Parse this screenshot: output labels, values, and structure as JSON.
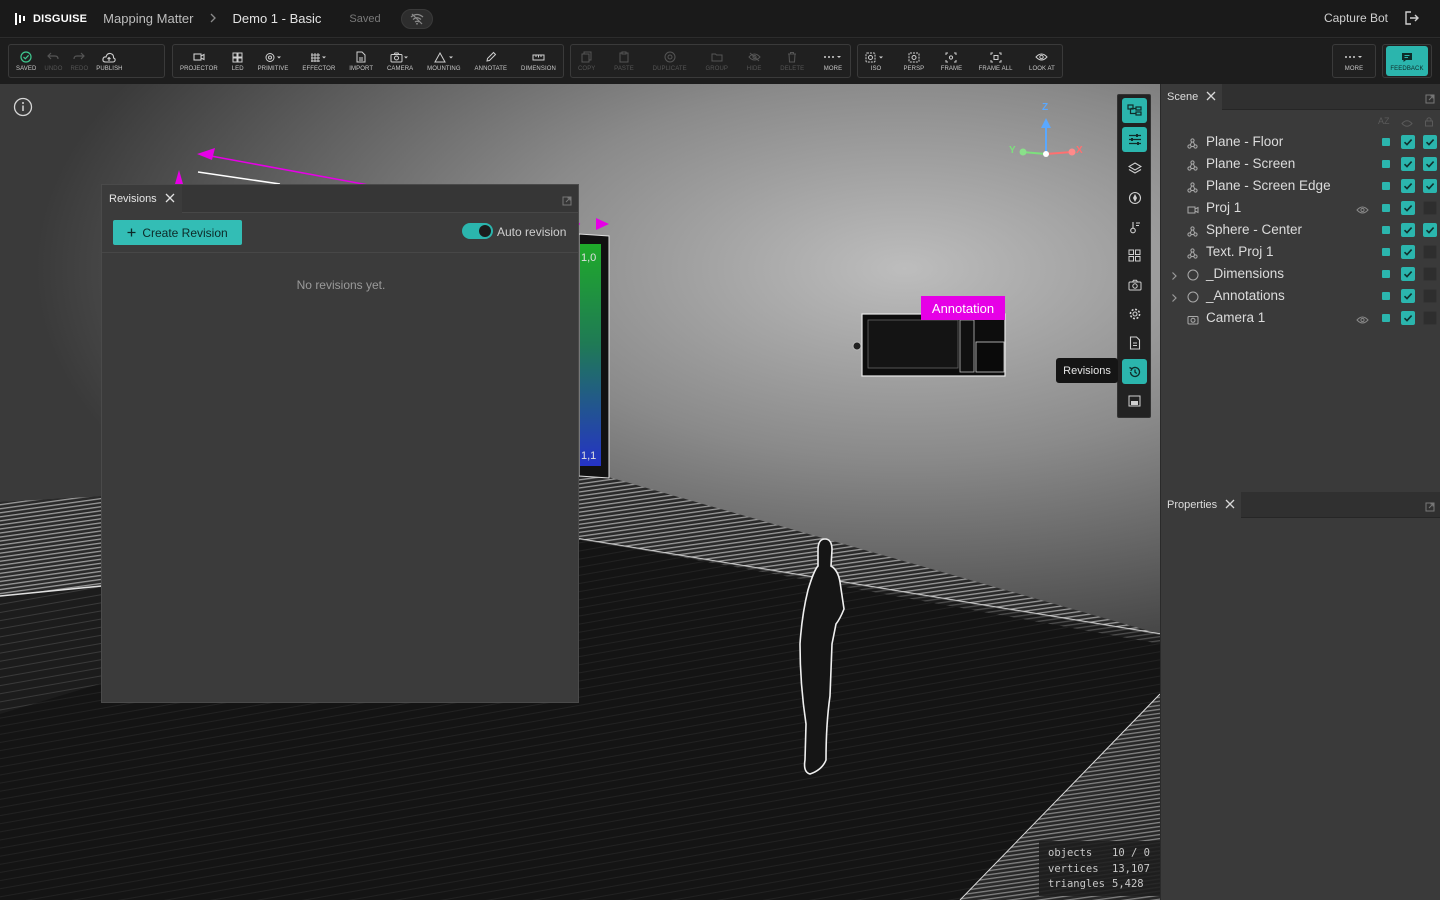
{
  "topbar": {
    "brand": "DISGUISE",
    "breadcrumb_1": "Mapping Matter",
    "breadcrumb_2": "Demo 1 - Basic",
    "save_status": "Saved",
    "user": "Capture Bot"
  },
  "toolbar": {
    "group1": [
      {
        "label": "SAVED",
        "icon": "check-circle-icon"
      },
      {
        "label": "UNDO",
        "icon": "undo-icon",
        "disabled": true
      },
      {
        "label": "REDO",
        "icon": "redo-icon",
        "disabled": true
      },
      {
        "label": "PUBLISH",
        "icon": "cloud-upload-icon"
      }
    ],
    "group2": [
      {
        "label": "PROJECTOR",
        "icon": "projector-icon"
      },
      {
        "label": "LED",
        "icon": "led-grid-icon"
      },
      {
        "label": "PRIMITIVE",
        "icon": "primitive-icon"
      },
      {
        "label": "EFFECTOR",
        "icon": "effector-icon"
      },
      {
        "label": "IMPORT",
        "icon": "import-file-icon"
      },
      {
        "label": "CAMERA",
        "icon": "camera-icon"
      },
      {
        "label": "MOUNTING",
        "icon": "mounting-icon"
      },
      {
        "label": "ANNOTATE",
        "icon": "pencil-icon"
      },
      {
        "label": "DIMENSION",
        "icon": "ruler-icon"
      }
    ],
    "group3": [
      {
        "label": "COPY",
        "icon": "copy-icon",
        "disabled": true
      },
      {
        "label": "PASTE",
        "icon": "paste-icon",
        "disabled": true
      },
      {
        "label": "DUPLICATE",
        "icon": "duplicate-icon",
        "disabled": true
      },
      {
        "label": "GROUP",
        "icon": "folder-icon",
        "disabled": true
      },
      {
        "label": "HIDE",
        "icon": "eye-off-icon",
        "disabled": true
      },
      {
        "label": "DELETE",
        "icon": "trash-icon",
        "disabled": true
      },
      {
        "label": "MORE",
        "icon": "more-dots-icon"
      }
    ],
    "group4": [
      {
        "label": "ISO",
        "icon": "iso-view-icon"
      },
      {
        "label": "PERSP",
        "icon": "perspective-icon"
      },
      {
        "label": "FRAME",
        "icon": "frame-icon"
      },
      {
        "label": "FRAME ALL",
        "icon": "frame-all-icon"
      },
      {
        "label": "LOOK AT",
        "icon": "eye-icon"
      }
    ],
    "more_label": "MORE",
    "feedback_label": "FEEDBACK"
  },
  "revisions": {
    "tab_label": "Revisions",
    "create_button": "Create Revision",
    "auto_revision_label": "Auto revision",
    "auto_revision_on": true,
    "empty_text": "No revisions yet."
  },
  "viewport": {
    "annotation_label": "Annotation",
    "tooltip": "Revisions",
    "axis_labels": {
      "z": "Z",
      "y": "Y",
      "x": "X"
    },
    "stats": [
      {
        "key": "objects",
        "value": "10 / 0"
      },
      {
        "key": "vertices",
        "value": "13,107"
      },
      {
        "key": "triangles",
        "value": "5,428"
      }
    ],
    "screen_labels": [
      "1,0",
      "1,1"
    ]
  },
  "scene": {
    "tab_label": "Scene",
    "sort_label": "AZ",
    "items": [
      {
        "name": "Plane - Floor",
        "icon": "mesh-icon",
        "expand": false,
        "eye": false,
        "vis": true,
        "lock": true
      },
      {
        "name": "Plane - Screen",
        "icon": "mesh-icon",
        "expand": false,
        "eye": false,
        "vis": true,
        "lock": true
      },
      {
        "name": "Plane - Screen Edge",
        "icon": "mesh-icon",
        "expand": false,
        "eye": false,
        "vis": true,
        "lock": true
      },
      {
        "name": "Proj 1",
        "icon": "projector-icon",
        "expand": false,
        "eye": true,
        "vis": true,
        "lock": false
      },
      {
        "name": "Sphere - Center",
        "icon": "mesh-icon",
        "expand": false,
        "eye": false,
        "vis": true,
        "lock": true
      },
      {
        "name": "Text. Proj 1",
        "icon": "mesh-icon",
        "expand": false,
        "eye": false,
        "vis": true,
        "lock": false
      },
      {
        "name": "_Dimensions",
        "icon": "circle-group-icon",
        "expand": true,
        "eye": false,
        "vis": true,
        "lock": false
      },
      {
        "name": "_Annotations",
        "icon": "circle-group-icon",
        "expand": true,
        "eye": false,
        "vis": true,
        "lock": false
      },
      {
        "name": "Camera 1",
        "icon": "camera-icon",
        "expand": false,
        "eye": true,
        "vis": true,
        "lock": false
      }
    ]
  },
  "properties": {
    "tab_label": "Properties"
  },
  "colors": {
    "accent": "#2bb5ad",
    "annotation": "#e600e6"
  }
}
